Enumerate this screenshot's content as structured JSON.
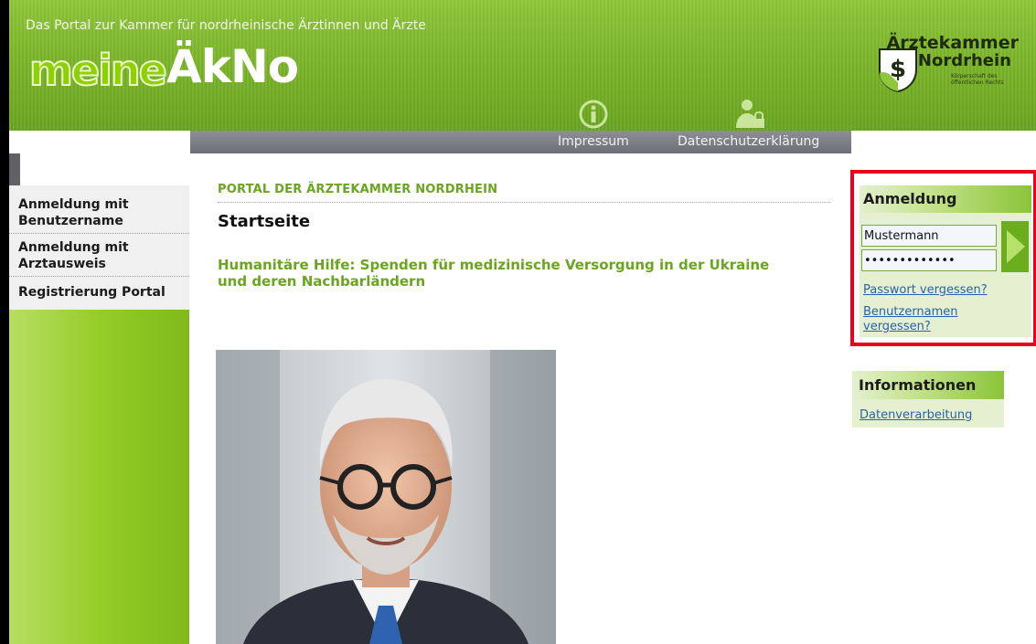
{
  "header": {
    "tagline": "Das Portal zur Kammer für nordrheinische Ärztinnen und Ärzte",
    "logo_part1": "meine",
    "logo_part2": "ÄkNo",
    "chamber_logo": {
      "line1": "Ärztekammer",
      "line2": "Nordrhein",
      "line3": "Körperschaft des öffentlichen Rechts"
    }
  },
  "top_nav": {
    "impressum": "Impressum",
    "datenschutz": "Datenschutzerklärung",
    "icons": [
      "info-icon",
      "user-lock-icon"
    ]
  },
  "sidebar": {
    "items": [
      {
        "label": "Anmeldung mit Benutzername"
      },
      {
        "label": "Anmeldung mit Arztausweis"
      },
      {
        "label": "Registrierung Portal"
      }
    ]
  },
  "main": {
    "portal_title": "PORTAL DER ÄRZTEKAMMER NORDRHEIN",
    "page_title": "Startseite",
    "news_headline": "Humanitäre Hilfe: Spenden für medizinische Versorgung in der Ukraine und deren Nachbarländern"
  },
  "login": {
    "title": "Anmeldung",
    "username_value": "Mustermann",
    "password_value": "•••••••••••••",
    "forgot_password": "Passwort vergessen?",
    "forgot_username": "Benutzernamen vergessen?",
    "highlight_color": "#e8001c"
  },
  "info": {
    "title": "Informationen",
    "link": "Datenverarbeitung"
  },
  "colors": {
    "brand_green": "#7cb52a",
    "link_blue": "#2a62a8"
  }
}
